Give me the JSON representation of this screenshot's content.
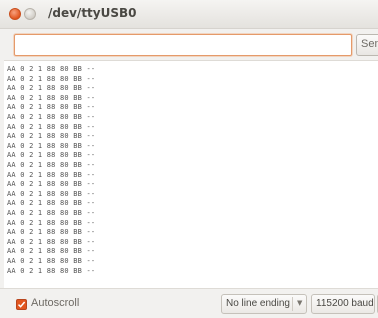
{
  "window": {
    "title": "/dev/ttyUSB0"
  },
  "send": {
    "input_value": "",
    "button_label": "Send"
  },
  "output": {
    "lines": [
      "AA 0 2 1 88 80 BB --",
      "AA 0 2 1 88 80 BB --",
      "AA 0 2 1 88 80 BB --",
      "AA 0 2 1 88 80 BB --",
      "AA 0 2 1 88 80 BB --",
      "AA 0 2 1 88 80 BB --",
      "AA 0 2 1 88 80 BB --",
      "AA 0 2 1 88 80 BB --",
      "AA 0 2 1 88 80 BB --",
      "AA 0 2 1 88 80 BB --",
      "AA 0 2 1 88 80 BB --",
      "AA 0 2 1 88 80 BB --",
      "AA 0 2 1 88 80 BB --",
      "AA 0 2 1 88 80 BB --",
      "AA 0 2 1 88 80 BB --",
      "AA 0 2 1 88 80 BB --",
      "AA 0 2 1 88 80 BB --",
      "AA 0 2 1 88 80 BB --",
      "AA 0 2 1 88 80 BB --",
      "AA 0 2 1 88 80 BB --",
      "AA 0 2 1 88 80 BB --",
      "AA 0 2 1 88 80 BB --"
    ]
  },
  "footer": {
    "autoscroll_label": "Autoscroll",
    "autoscroll_checked": true,
    "line_ending": "No line ending",
    "baud": "115200 baud"
  },
  "colors": {
    "accent": "#e2561f",
    "focus_border": "#e59a6a"
  }
}
